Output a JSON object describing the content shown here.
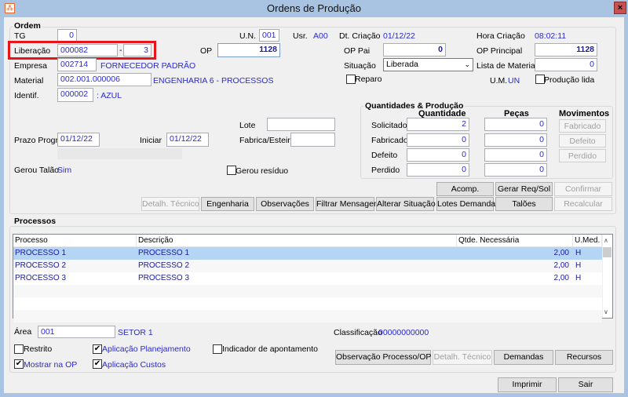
{
  "window": {
    "title": "Ordens de Produção",
    "app_icon": "app-logo-icon",
    "close_icon": "×"
  },
  "ordem": {
    "group_title": "Ordem",
    "tg": {
      "label": "TG",
      "value": "0"
    },
    "liberacao": {
      "label": "Liberação",
      "value": "000082",
      "sep": "-",
      "seq": "3"
    },
    "op": {
      "label": "OP",
      "value": "1128"
    },
    "un": {
      "label": "U.N.",
      "value": "001"
    },
    "usr": {
      "label": "Usr.",
      "value": "A00"
    },
    "dt_criacao": {
      "label": "Dt. Criação",
      "value": "01/12/22"
    },
    "hora_criacao": {
      "label": "Hora Criação",
      "value": "08:02:11"
    },
    "op_pai": {
      "label": "OP Pai",
      "value": "0"
    },
    "op_principal": {
      "label": "OP Principal",
      "value": "1128"
    },
    "situacao": {
      "label": "Situação",
      "value": "Liberada"
    },
    "lista_materiais": {
      "label": "Lista de Materiais",
      "value": "0"
    },
    "reparo": {
      "label": "Reparo",
      "checked": false
    },
    "um": {
      "label": "U.M.",
      "value": "UN"
    },
    "producao_lida": {
      "label": "Produção lida",
      "checked": false
    },
    "empresa": {
      "label": "Empresa",
      "value": "002714",
      "desc": "FORNECEDOR PADRÃO"
    },
    "material": {
      "label": "Material",
      "value": "002.001.000006",
      "desc": "ENGENHARIA 6 - PROCESSOS"
    },
    "identif": {
      "label": "Identif.",
      "value": "000002",
      "desc": ": AZUL"
    },
    "lote": {
      "label": "Lote",
      "value": ""
    },
    "prazo": {
      "label": "Prazo Progr.",
      "value": "01/12/22"
    },
    "iniciar": {
      "label": "Iniciar",
      "value": "01/12/22"
    },
    "fabrica": {
      "label": "Fabrica/Esteira",
      "value": ""
    },
    "gerou_talao": {
      "label": "Gerou Talão",
      "value": "Sim"
    },
    "gerou_residuo": {
      "label": "Gerou resíduo",
      "checked": false
    }
  },
  "quantidades": {
    "title": "Quantidades & Produção",
    "headers": [
      "Quantidade",
      "Peças",
      "Movimentos"
    ],
    "rows": [
      {
        "label": "Solicitado",
        "qtd": "2",
        "pecas": "0"
      },
      {
        "label": "Fabricado",
        "qtd": "0",
        "pecas": "0",
        "button": "Fabricado"
      },
      {
        "label": "Defeito",
        "qtd": "0",
        "pecas": "0",
        "button": "Defeito"
      },
      {
        "label": "Perdido",
        "qtd": "0",
        "pecas": "0",
        "button": "Perdido"
      }
    ]
  },
  "buttons": {
    "acomp": "Acomp.",
    "gerar": "Gerar Req/Sol",
    "confirmar": "Confirmar",
    "detalh": "Detalh. Técnico",
    "engenharia": "Engenharia",
    "observacoes": "Observações",
    "filtrar": "Filtrar Mensagens",
    "alterar": "Alterar Situação",
    "lotes": "Lotes Demandas",
    "taloes": "Talões",
    "recalcular": "Recalcular"
  },
  "processos": {
    "title": "Processos",
    "columns": [
      "Processo",
      "Descrição",
      "Qtde. Necessária",
      "U.Med."
    ],
    "rows": [
      {
        "processo": "PROCESSO 1",
        "descricao": "PROCESSO 1",
        "qtde": "2,00",
        "umed": "H"
      },
      {
        "processo": "PROCESSO 2",
        "descricao": "PROCESSO 2",
        "qtde": "2,00",
        "umed": "H"
      },
      {
        "processo": "PROCESSO 3",
        "descricao": "PROCESSO 3",
        "qtde": "2,00",
        "umed": "H"
      }
    ],
    "area": {
      "label": "Área",
      "value": "001",
      "desc": "SETOR 1"
    },
    "classificacao": {
      "label": "Classificação",
      "value": "00000000000"
    },
    "checks": {
      "restrito": "Restrito",
      "aplic_plan": "Aplicação Planejamento",
      "indicador": "Indicador de apontamento",
      "mostrar": "Mostrar na OP",
      "aplic_custos": "Aplicação Custos"
    },
    "checked": {
      "restrito": false,
      "aplic_plan": true,
      "indicador": false,
      "mostrar": true,
      "aplic_custos": true
    },
    "buttons": {
      "observacao": "Observação Processo/OP",
      "detalh": "Detalh. Técnico",
      "demandas": "Demandas",
      "recursos": "Recursos"
    }
  },
  "footer": {
    "imprimir": "Imprimir",
    "sair": "Sair"
  }
}
